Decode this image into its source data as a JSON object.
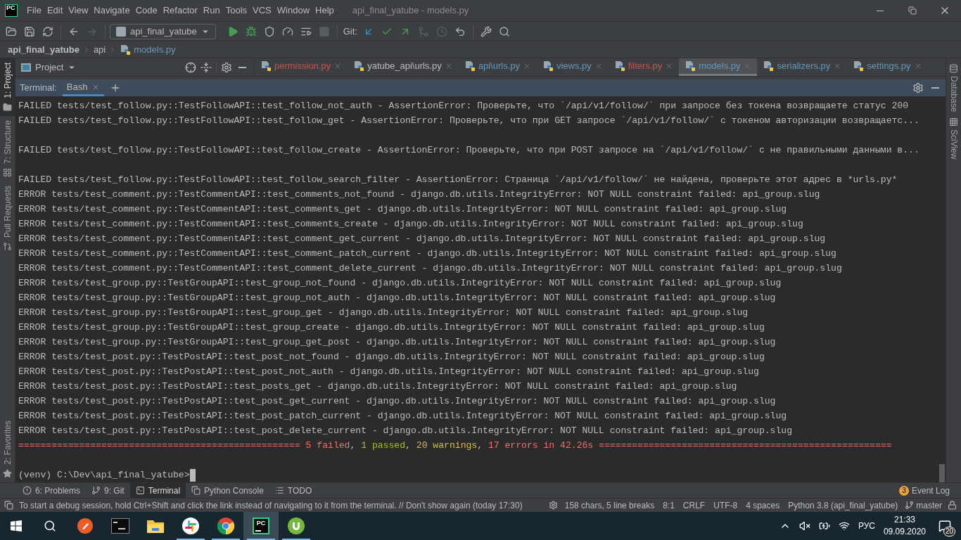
{
  "title_bar": {
    "logo": "PC",
    "menu": [
      "File",
      "Edit",
      "View",
      "Navigate",
      "Code",
      "Refactor",
      "Run",
      "Tools",
      "VCS",
      "Window",
      "Help"
    ],
    "title": "api_final_yatube - models.py"
  },
  "toolbar": {
    "file_tools": [
      {
        "kind": "open",
        "disabled": false
      },
      {
        "kind": "save",
        "disabled": false
      },
      {
        "kind": "sync",
        "disabled": false
      }
    ],
    "nav_tools": [
      {
        "kind": "back",
        "disabled": false
      },
      {
        "kind": "forward",
        "disabled": true
      }
    ],
    "run_config": "api_final_yatube",
    "run_tools": [
      {
        "kind": "run",
        "disabled": false
      },
      {
        "kind": "debug",
        "disabled": false
      },
      {
        "kind": "coverage",
        "disabled": false
      },
      {
        "kind": "profile",
        "disabled": false
      },
      {
        "kind": "concurrency",
        "disabled": false
      },
      {
        "kind": "stop",
        "disabled": true
      }
    ],
    "git_label": "Git:",
    "git_tools": [
      {
        "kind": "update",
        "disabled": false
      },
      {
        "kind": "commit",
        "disabled": false
      },
      {
        "kind": "push",
        "disabled": false
      },
      {
        "kind": "compare",
        "disabled": true
      },
      {
        "kind": "history",
        "disabled": true
      },
      {
        "kind": "rollback",
        "disabled": false
      }
    ],
    "end_tools": [
      {
        "kind": "settings",
        "disabled": false
      },
      {
        "kind": "search",
        "disabled": false
      }
    ]
  },
  "breadcrumbs": [
    "api_final_yatube",
    "api",
    "models.py"
  ],
  "left_strip": [
    {
      "label": "1: Project",
      "selected": true,
      "kind": "folder"
    },
    {
      "label": "7: Structure",
      "selected": false,
      "kind": "structure"
    },
    {
      "label": "Pull Requests",
      "selected": false,
      "kind": "pull"
    },
    {
      "label": "2: Favorites",
      "selected": false,
      "kind": "star"
    }
  ],
  "right_strip": [
    {
      "label": "Database",
      "kind": "database"
    },
    {
      "label": "SciView",
      "kind": "sciview"
    }
  ],
  "project_panel": {
    "title": "Project"
  },
  "editor_tabs": [
    {
      "label": "permission.py",
      "color": "#c75450",
      "selected": false
    },
    {
      "label": "yatube_api\\urls.py",
      "color": "#bbbbbb",
      "selected": false
    },
    {
      "label": "api\\urls.py",
      "color": "#6897bb",
      "selected": false
    },
    {
      "label": "views.py",
      "color": "#6897bb",
      "selected": false
    },
    {
      "label": "filters.py",
      "color": "#c75450",
      "selected": false
    },
    {
      "label": "models.py",
      "color": "#6897bb",
      "selected": true
    },
    {
      "label": "serializers.py",
      "color": "#6897bb",
      "selected": false
    },
    {
      "label": "settings.py",
      "color": "#6897bb",
      "selected": false
    }
  ],
  "terminal": {
    "label": "Terminal:",
    "tab": "Bash",
    "blocks": [
      [
        "FAILED tests/test_follow.py::TestFollowAPI::test_follow_not_auth - AssertionError: Проверьте, что `/api/v1/follow/` при запросе без токена возвращаете статус 200",
        "FAILED tests/test_follow.py::TestFollowAPI::test_follow_get - AssertionError: Проверьте, что при GET запросе `/api/v1/follow/` с токеном авторизации возвращаетс..."
      ],
      [
        "FAILED tests/test_follow.py::TestFollowAPI::test_follow_create - AssertionError: Проверьте, что при POST запросе на `/api/v1/follow/` с не правильными данными в..."
      ],
      [
        "FAILED tests/test_follow.py::TestFollowAPI::test_follow_search_filter - AssertionError: Страница `/api/v1/follow/` не найдена, проверьте этот адрес в *urls.py*",
        "ERROR tests/test_comment.py::TestCommentAPI::test_comments_not_found - django.db.utils.IntegrityError: NOT NULL constraint failed: api_group.slug",
        "ERROR tests/test_comment.py::TestCommentAPI::test_comments_get - django.db.utils.IntegrityError: NOT NULL constraint failed: api_group.slug",
        "ERROR tests/test_comment.py::TestCommentAPI::test_comments_create - django.db.utils.IntegrityError: NOT NULL constraint failed: api_group.slug",
        "ERROR tests/test_comment.py::TestCommentAPI::test_comment_get_current - django.db.utils.IntegrityError: NOT NULL constraint failed: api_group.slug",
        "ERROR tests/test_comment.py::TestCommentAPI::test_comment_patch_current - django.db.utils.IntegrityError: NOT NULL constraint failed: api_group.slug",
        "ERROR tests/test_comment.py::TestCommentAPI::test_comment_delete_current - django.db.utils.IntegrityError: NOT NULL constraint failed: api_group.slug",
        "ERROR tests/test_group.py::TestGroupAPI::test_group_not_found - django.db.utils.IntegrityError: NOT NULL constraint failed: api_group.slug",
        "ERROR tests/test_group.py::TestGroupAPI::test_group_not_auth - django.db.utils.IntegrityError: NOT NULL constraint failed: api_group.slug",
        "ERROR tests/test_group.py::TestGroupAPI::test_group_get - django.db.utils.IntegrityError: NOT NULL constraint failed: api_group.slug",
        "ERROR tests/test_group.py::TestGroupAPI::test_group_create - django.db.utils.IntegrityError: NOT NULL constraint failed: api_group.slug",
        "ERROR tests/test_group.py::TestGroupAPI::test_group_get_post - django.db.utils.IntegrityError: NOT NULL constraint failed: api_group.slug",
        "ERROR tests/test_post.py::TestPostAPI::test_post_not_found - django.db.utils.IntegrityError: NOT NULL constraint failed: api_group.slug",
        "ERROR tests/test_post.py::TestPostAPI::test_post_not_auth - django.db.utils.IntegrityError: NOT NULL constraint failed: api_group.slug",
        "ERROR tests/test_post.py::TestPostAPI::test_posts_get - django.db.utils.IntegrityError: NOT NULL constraint failed: api_group.slug",
        "ERROR tests/test_post.py::TestPostAPI::test_post_get_current - django.db.utils.IntegrityError: NOT NULL constraint failed: api_group.slug",
        "ERROR tests/test_post.py::TestPostAPI::test_post_patch_current - django.db.utils.IntegrityError: NOT NULL constraint failed: api_group.slug",
        "ERROR tests/test_post.py::TestPostAPI::test_post_delete_current - django.db.utils.IntegrityError: NOT NULL constraint failed: api_group.slug"
      ]
    ],
    "summary": [
      {
        "text": "=================================================== ",
        "color": "#ff6b68"
      },
      {
        "text": "5 failed",
        "color": "#ff6b68"
      },
      {
        "text": ", "
      },
      {
        "text": "1 passed",
        "color": "#a8c023"
      },
      {
        "text": ", "
      },
      {
        "text": "20 warnings",
        "color": "#d6bf55"
      },
      {
        "text": ", "
      },
      {
        "text": "17 errors in 42.26s =====================================================",
        "color": "#ff6b68"
      }
    ],
    "prompt": "(venv) C:\\Dev\\api_final_yatube>"
  },
  "tool_tabs": [
    {
      "label": "6: Problems",
      "kind": "problems",
      "selected": false
    },
    {
      "label": "9: Git",
      "kind": "git",
      "selected": false
    },
    {
      "label": "Terminal",
      "kind": "terminal",
      "selected": true
    },
    {
      "label": "Python Console",
      "kind": "python",
      "selected": false
    },
    {
      "label": "TODO",
      "kind": "todo",
      "selected": false
    }
  ],
  "event_log": {
    "count": "3",
    "label": "Event Log"
  },
  "status_bar": {
    "message": "To start a debug session, hold Ctrl+Shift and click the link instead of navigating to it from the terminal. // Don't show again (today 17:30)",
    "items": [
      "158 chars, 5 line breaks",
      "8:1",
      "CRLF",
      "UTF-8",
      "4 spaces",
      "Python 3.8 (api_final_yatube)"
    ],
    "branch": "master"
  },
  "taskbar": {
    "apps": [
      {
        "kind": "postman",
        "running": false,
        "selected": false
      },
      {
        "kind": "cmd",
        "running": false,
        "selected": false
      },
      {
        "kind": "explorer",
        "running": false,
        "selected": false
      },
      {
        "kind": "slack",
        "running": true,
        "selected": false
      },
      {
        "kind": "chrome",
        "running": true,
        "selected": false
      },
      {
        "kind": "pycharm",
        "running": true,
        "selected": true
      },
      {
        "kind": "utorrent",
        "running": true,
        "selected": false
      }
    ],
    "pycharm_logo": "PC",
    "language": "РУС",
    "time": "21:33",
    "date": "09.09.2020",
    "notifications": "20"
  }
}
